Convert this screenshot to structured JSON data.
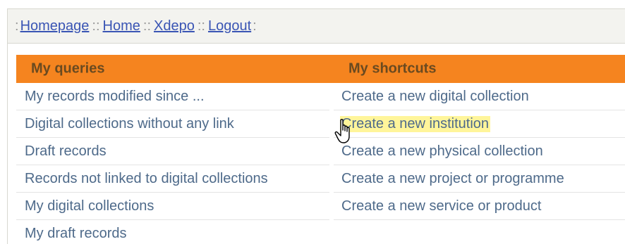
{
  "nav": {
    "lead_sep": ":",
    "items": [
      {
        "label": "Homepage",
        "sep": "::"
      },
      {
        "label": "Home",
        "sep": "::"
      },
      {
        "label": "Xdepo",
        "sep": "::"
      },
      {
        "label": "Logout",
        "sep": ":"
      }
    ]
  },
  "queries": {
    "title": "My queries",
    "items": [
      "My records modified since ...",
      "Digital collections without any link",
      "Draft records",
      "Records not linked to digital collections",
      "My digital collections",
      "My draft records"
    ]
  },
  "shortcuts": {
    "title": "My shortcuts",
    "items": [
      "Create a new digital collection",
      "Create a new institution",
      "Create a new physical collection",
      "Create a new project or programme",
      "Create a new service or product"
    ],
    "highlighted_index": 1
  },
  "colors": {
    "header_bg": "#f5841f",
    "header_text": "#6a4a20",
    "link": "#3a55b4",
    "row_text": "#4e6a8a",
    "highlight": "#fff59a"
  },
  "cursor_icon": "hand-pointer-icon"
}
